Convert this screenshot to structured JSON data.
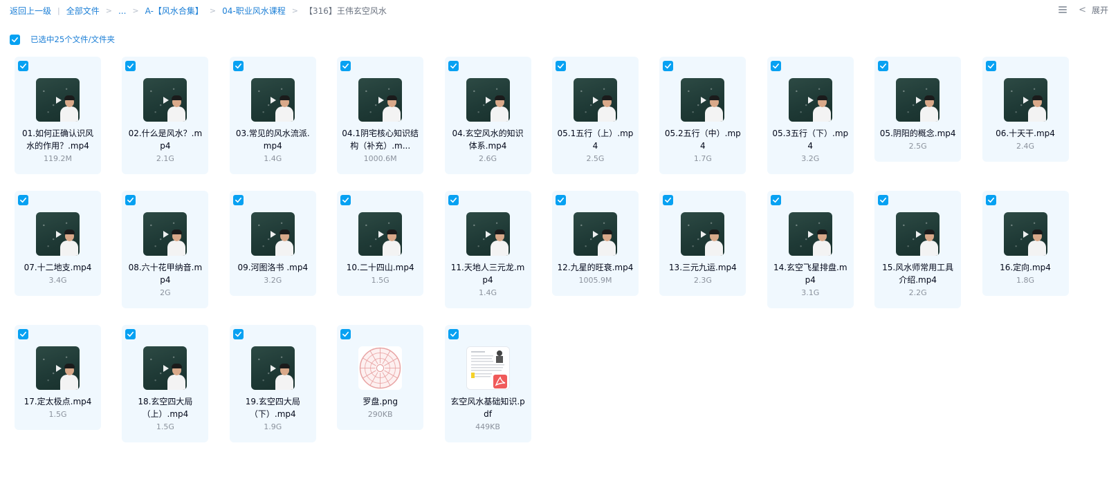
{
  "breadcrumb": {
    "back": "返回上一级",
    "all_files": "全部文件",
    "ellipsis": "...",
    "level1": "A-【风水合集】",
    "level2": "04-职业风水课程",
    "current": "【316】王伟玄空风水",
    "separator_pipe": "|",
    "separator_arrow": ">"
  },
  "toolbar": {
    "expand_label": "展开",
    "collapse_chevron": "<"
  },
  "selection": {
    "label": "已选中25个文件/文件夹",
    "checked": true
  },
  "colors": {
    "accent": "#07a1f2",
    "link": "#1c7fd6",
    "card_bg": "#f0f8fe"
  },
  "files": [
    {
      "name": "01.如何正确认识风水的作用？.mp4",
      "size": "119.2M",
      "type": "video",
      "icon": "video-thumbnail"
    },
    {
      "name": "02.什么是风水？.mp4",
      "size": "2.1G",
      "type": "video",
      "icon": "video-thumbnail"
    },
    {
      "name": "03.常见的风水流派.mp4",
      "size": "1.4G",
      "type": "video",
      "icon": "video-thumbnail"
    },
    {
      "name": "04.1阴宅核心知识结构（补充）.m...",
      "size": "1000.6M",
      "type": "video",
      "icon": "video-thumbnail"
    },
    {
      "name": "04.玄空风水的知识体系.mp4",
      "size": "2.6G",
      "type": "video",
      "icon": "video-thumbnail"
    },
    {
      "name": "05.1五行（上）.mp4",
      "size": "2.5G",
      "type": "video",
      "icon": "video-thumbnail"
    },
    {
      "name": "05.2五行（中）.mp4",
      "size": "1.7G",
      "type": "video",
      "icon": "video-thumbnail"
    },
    {
      "name": "05.3五行（下）.mp4",
      "size": "3.2G",
      "type": "video",
      "icon": "video-thumbnail"
    },
    {
      "name": "05.阴阳的概念.mp4",
      "size": "2.5G",
      "type": "video",
      "icon": "video-thumbnail"
    },
    {
      "name": "06.十天干.mp4",
      "size": "2.4G",
      "type": "video",
      "icon": "video-thumbnail"
    },
    {
      "name": "07.十二地支.mp4",
      "size": "3.4G",
      "type": "video",
      "icon": "video-thumbnail"
    },
    {
      "name": "08.六十花甲纳音.mp4",
      "size": "2G",
      "type": "video",
      "icon": "video-thumbnail"
    },
    {
      "name": "09.河图洛书 .mp4",
      "size": "3.2G",
      "type": "video",
      "icon": "video-thumbnail"
    },
    {
      "name": "10.二十四山.mp4",
      "size": "1.5G",
      "type": "video",
      "icon": "video-thumbnail"
    },
    {
      "name": "11.天地人三元龙.mp4",
      "size": "1.4G",
      "type": "video",
      "icon": "video-thumbnail"
    },
    {
      "name": "12.九星的旺衰.mp4",
      "size": "1005.9M",
      "type": "video",
      "icon": "video-thumbnail"
    },
    {
      "name": "13.三元九运.mp4",
      "size": "2.3G",
      "type": "video",
      "icon": "video-thumbnail"
    },
    {
      "name": "14.玄空飞星排盘.mp4",
      "size": "3.1G",
      "type": "video",
      "icon": "video-thumbnail"
    },
    {
      "name": "15.风水师常用工具介绍.mp4",
      "size": "2.2G",
      "type": "video",
      "icon": "video-thumbnail"
    },
    {
      "name": "16.定向.mp4",
      "size": "1.8G",
      "type": "video",
      "icon": "video-thumbnail"
    },
    {
      "name": "17.定太极点.mp4",
      "size": "1.5G",
      "type": "video",
      "icon": "video-thumbnail"
    },
    {
      "name": "18.玄空四大局（上）.mp4",
      "size": "1.5G",
      "type": "video",
      "icon": "video-thumbnail"
    },
    {
      "name": "19.玄空四大局（下）.mp4",
      "size": "1.9G",
      "type": "video",
      "icon": "video-thumbnail"
    },
    {
      "name": "罗盘.png",
      "size": "290KB",
      "type": "image",
      "icon": "compass-image-thumbnail"
    },
    {
      "name": "玄空风水基础知识.pdf",
      "size": "449KB",
      "type": "pdf",
      "icon": "pdf-document-thumbnail"
    }
  ]
}
